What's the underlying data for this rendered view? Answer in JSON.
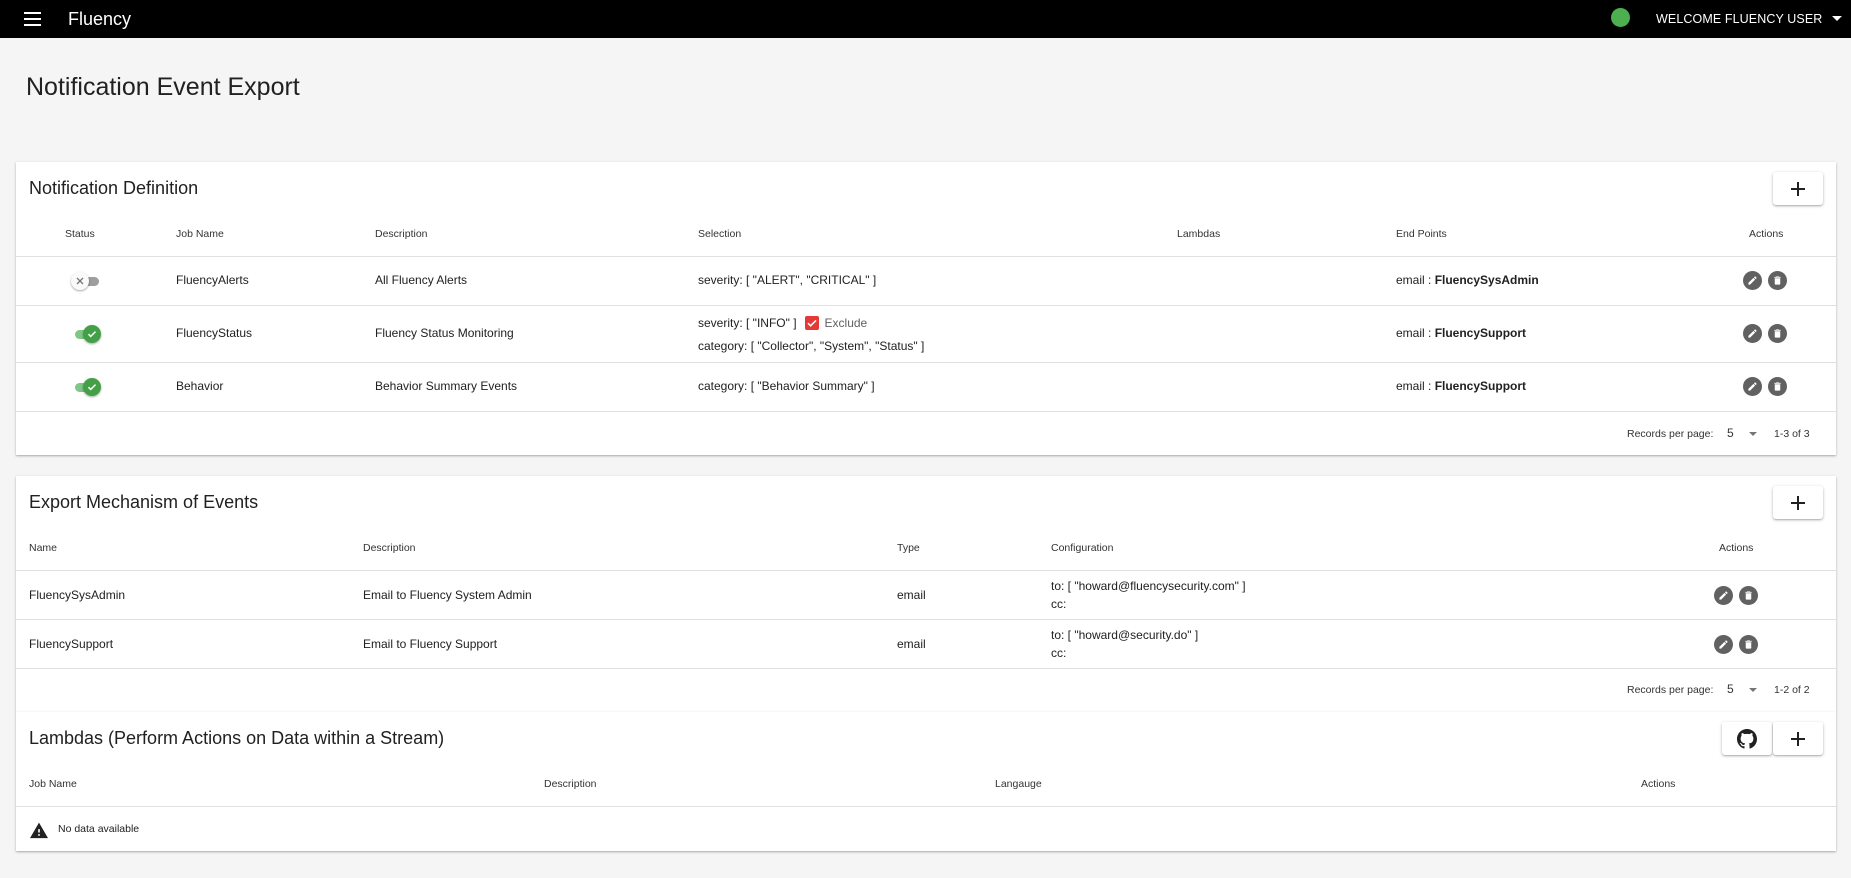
{
  "appbar": {
    "title": "Fluency",
    "user_label": "WELCOME FLUENCY USER",
    "status_color": "#4caf50"
  },
  "page": {
    "title": "Notification Event Export"
  },
  "notification": {
    "title": "Notification Definition",
    "columns": [
      "Status",
      "Job Name",
      "Description",
      "Selection",
      "Lambdas",
      "End Points",
      "Actions"
    ],
    "rows": [
      {
        "enabled": false,
        "job_name": "FluencyAlerts",
        "description": "All Fluency Alerts",
        "selection_1": "severity: [ \"ALERT\", \"CRITICAL\" ]",
        "endpoint_prefix": "email : ",
        "endpoint_name": "FluencySysAdmin"
      },
      {
        "enabled": true,
        "job_name": "FluencyStatus",
        "description": "Fluency Status Monitoring",
        "selection_1": "severity: [ \"INFO\" ]",
        "exclude_label": "Exclude",
        "exclude_checked": true,
        "selection_2": "category: [ \"Collector\", \"System\", \"Status\" ]",
        "endpoint_prefix": "email : ",
        "endpoint_name": "FluencySupport"
      },
      {
        "enabled": true,
        "job_name": "Behavior",
        "description": "Behavior Summary Events",
        "selection_1": "category: [ \"Behavior Summary\" ]",
        "endpoint_prefix": "email : ",
        "endpoint_name": "FluencySupport"
      }
    ],
    "pager": {
      "label": "Records per page:",
      "value": "5",
      "range": "1-3 of 3"
    }
  },
  "export": {
    "title": "Export Mechanism of Events",
    "columns": [
      "Name",
      "Description",
      "Type",
      "Configuration",
      "Actions"
    ],
    "rows": [
      {
        "name": "FluencySysAdmin",
        "description": "Email to Fluency System Admin",
        "type": "email",
        "config_to": "to: [ \"howard@fluencysecurity.com\" ]",
        "config_cc": "cc:"
      },
      {
        "name": "FluencySupport",
        "description": "Email to Fluency Support",
        "type": "email",
        "config_to": "to: [ \"howard@security.do\" ]",
        "config_cc": "cc:"
      }
    ],
    "pager": {
      "label": "Records per page:",
      "value": "5",
      "range": "1-2 of 2"
    }
  },
  "lambdas": {
    "title": "Lambdas (Perform Actions on Data within a Stream)",
    "columns": [
      "Job Name",
      "Description",
      "Langauge",
      "Actions"
    ],
    "empty_message": "No data available"
  },
  "icons": {
    "menu": "menu-icon",
    "add": "plus-icon",
    "edit": "pencil-icon",
    "delete": "trash-icon",
    "github": "github-icon",
    "warning": "warning-icon",
    "check": "check-icon",
    "close": "x-icon"
  },
  "colors": {
    "appbar_bg": "#000000",
    "switch_on": "#43a047",
    "checkbox": "#e53935",
    "action_icon": "#616161"
  }
}
